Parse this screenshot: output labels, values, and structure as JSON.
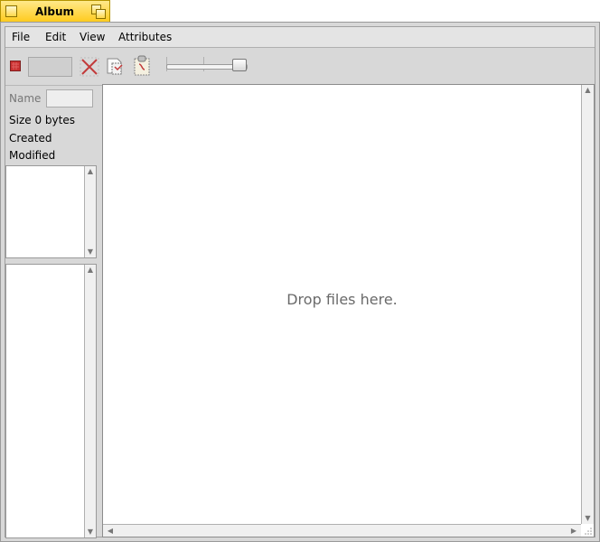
{
  "window": {
    "title": "Album"
  },
  "menu": {
    "items": [
      "File",
      "Edit",
      "View",
      "Attributes"
    ]
  },
  "toolbar": {
    "icons": [
      "stop-icon",
      "delete-icon",
      "copy-attributes-icon",
      "paste-attributes-icon"
    ],
    "zoom_slider_level": 0.95
  },
  "info": {
    "name_label": "Name",
    "name_value": "",
    "size_label": "Size 0 bytes",
    "created_label": "Created",
    "modified_label": "Modified"
  },
  "main": {
    "drop_hint": "Drop files here."
  },
  "colors": {
    "tab_yellow": "#ffcb1f",
    "window_gray": "#d8d8d8",
    "stop_red": "#c83030"
  }
}
